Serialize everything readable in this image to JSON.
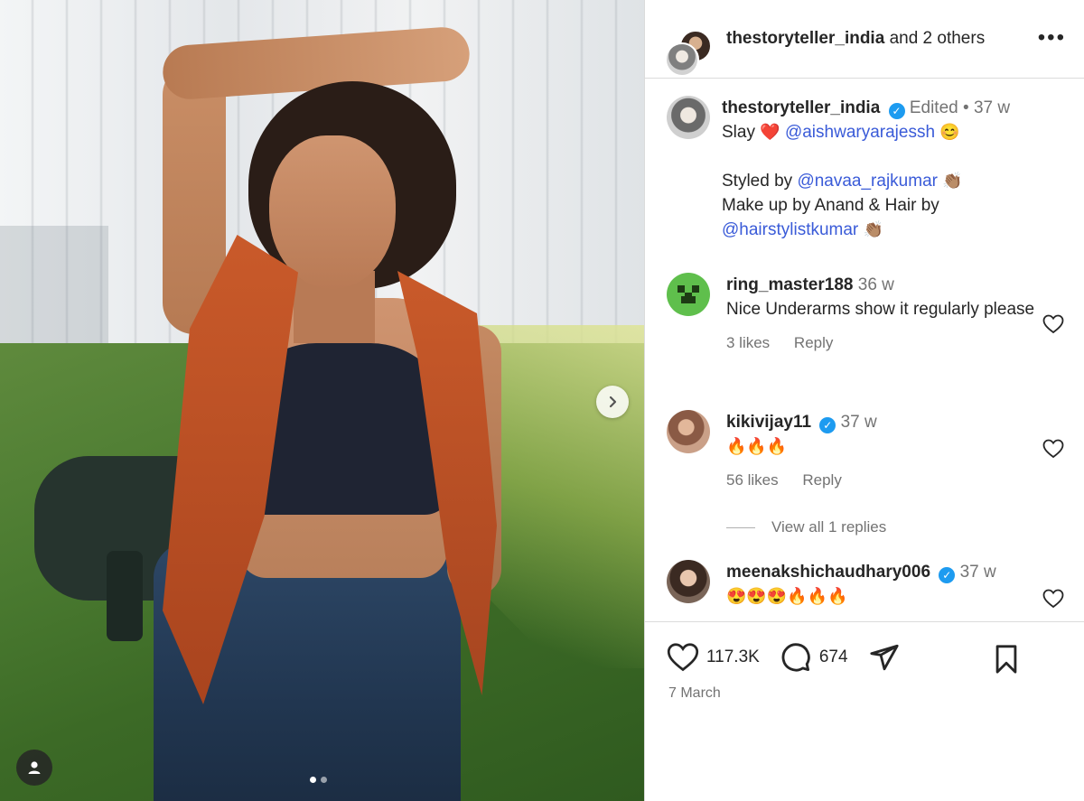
{
  "header": {
    "username": "thestoryteller_india",
    "collab_text": "and 2 others",
    "more_label": "•••"
  },
  "caption": {
    "username": "thestoryteller_india",
    "edited": "Edited",
    "time": "37 w",
    "line1_text": "Slay",
    "line1_emoji": "❤️",
    "line1_mention": "@aishwaryarajessh",
    "line1_emoji2": "😊",
    "styled_text": "Styled by",
    "styled_mention": "@navaa_rajkumar",
    "clap": "👏🏽",
    "makeup_text": "Make up by Anand & Hair by",
    "hair_mention": "@hairstylistkumar"
  },
  "comments": [
    {
      "username": "ring_master188",
      "time": "36 w",
      "text": "Nice Underarms show it regularly please",
      "likes": "3 likes",
      "reply": "Reply"
    },
    {
      "username": "kikivijay11",
      "time": "37 w",
      "text": "🔥🔥🔥",
      "likes": "56 likes",
      "reply": "Reply",
      "verified": true
    },
    {
      "username": "meenakshichaudhary006",
      "time": "37 w",
      "text": "😍😍😍🔥🔥🔥",
      "verified": true
    }
  ],
  "view_replies": "View all 1 replies",
  "stats": {
    "likes": "117.3K",
    "comments": "674"
  },
  "date": "7 March",
  "colors": {
    "accent_link": "#00376b",
    "verified": "#1d9bf0",
    "heart_red": "#e0245e"
  }
}
